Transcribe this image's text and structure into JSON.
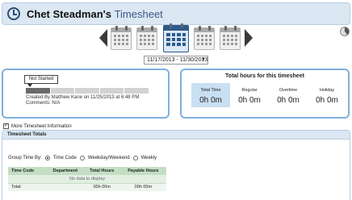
{
  "header": {
    "owner": "Chet Steadman's",
    "title_suffix": "Timesheet"
  },
  "period": {
    "selected": "11/17/2013 - 11/30/2013"
  },
  "status": {
    "label": "Not Started",
    "progress_completed": 1,
    "progress_total": 5,
    "created_text": "Created By Matthew Kane on 11/25/2013 at 6:48 PM",
    "comments_text": "Comments: N/A"
  },
  "hours": {
    "title": "Total hours for this timesheet",
    "cells": [
      {
        "label": "Total Time",
        "value": "0h 0m"
      },
      {
        "label": "Regular",
        "value": "0h 0m"
      },
      {
        "label": "Overtime",
        "value": "0h 0m"
      },
      {
        "label": "Holiday",
        "value": "0h 0m"
      }
    ]
  },
  "more_info": {
    "label": "More Timesheet Information",
    "checked": true
  },
  "totals": {
    "title": "Timesheet Totals",
    "group_label": "Group Time By:",
    "group_options": [
      "Time Code",
      "Weekday/Weekend",
      "Weekly"
    ],
    "selected_group": "Time Code",
    "columns": [
      "Time Code",
      "Department",
      "Total Hours",
      "Payable Hours"
    ],
    "empty_text": "No data to display",
    "total_row": {
      "label": "Total",
      "total_hours": "00h 00m",
      "payable_hours": "00h 00m"
    }
  }
}
